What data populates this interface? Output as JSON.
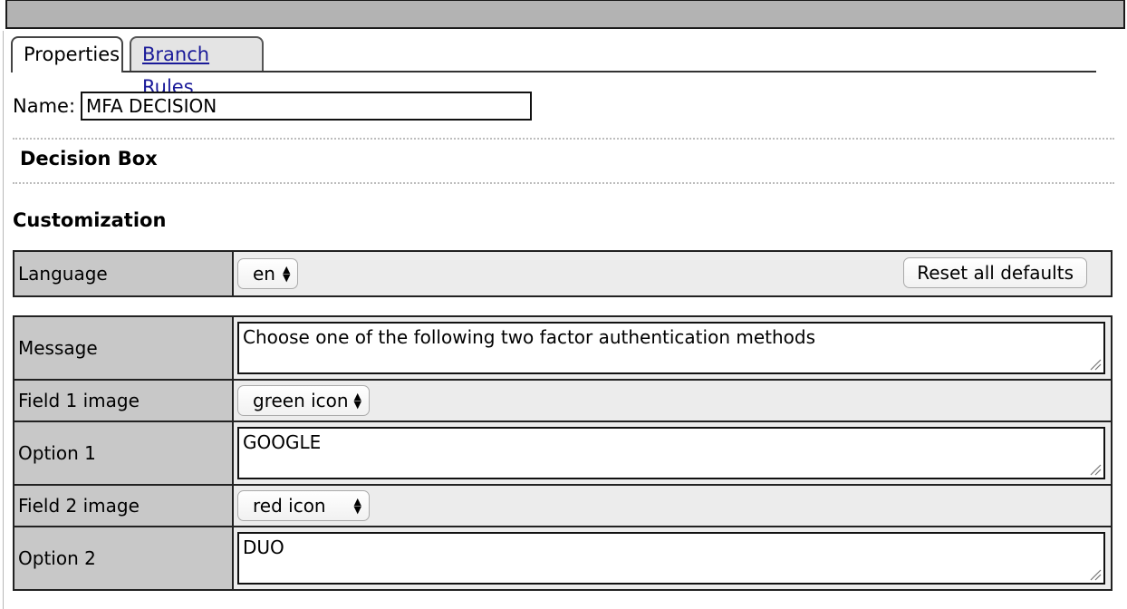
{
  "tabs": [
    {
      "label": "Properties",
      "active": true
    },
    {
      "label": "Branch Rules",
      "active": false
    }
  ],
  "name": {
    "label": "Name:",
    "value": "MFA DECISION"
  },
  "node_type": "Decision Box",
  "customization": {
    "title": "Customization",
    "language": {
      "label": "Language",
      "value": "en"
    },
    "reset_button": "Reset all defaults",
    "fields": {
      "message": {
        "label": "Message",
        "value": "Choose one of the following two factor authentication methods"
      },
      "field1_image": {
        "label": "Field 1 image",
        "value": "green icon"
      },
      "option1": {
        "label": "Option 1",
        "value": "GOOGLE"
      },
      "field2_image": {
        "label": "Field 2 image",
        "value": "red icon"
      },
      "option2": {
        "label": "Option 2",
        "value": "DUO"
      }
    }
  }
}
